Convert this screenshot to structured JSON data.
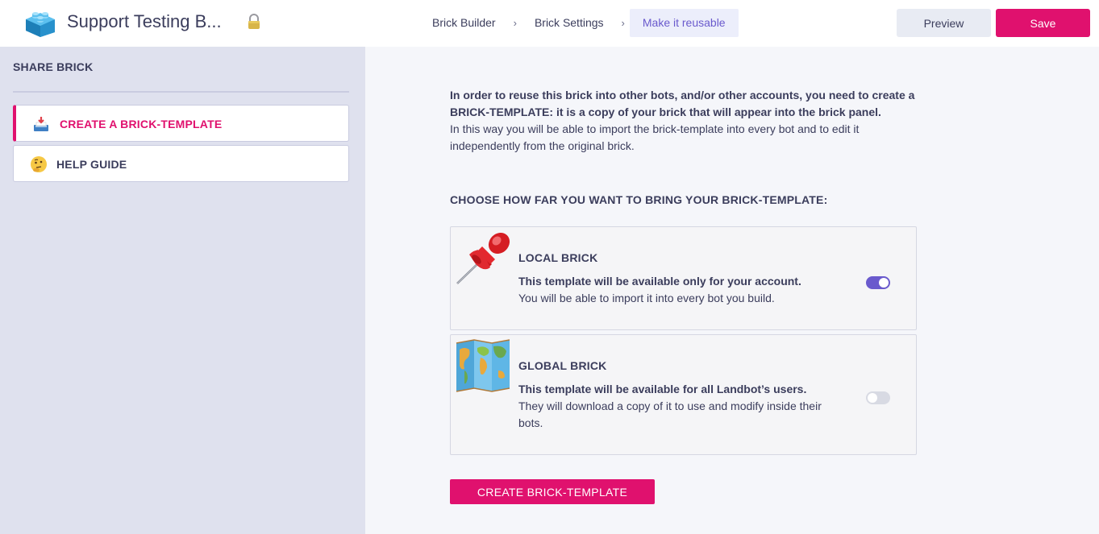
{
  "header": {
    "app_title": "Support Testing B...",
    "breadcrumbs": [
      "Brick Builder",
      "Brick Settings",
      "Make it reusable"
    ],
    "breadcrumb_separator": "›",
    "preview_label": "Preview",
    "save_label": "Save"
  },
  "sidebar": {
    "title": "SHARE BRICK",
    "items": [
      {
        "label": "CREATE A BRICK-TEMPLATE",
        "icon": "inbox-tray-icon",
        "active": true
      },
      {
        "label": "HELP GUIDE",
        "icon": "thinking-face-icon",
        "active": false
      }
    ]
  },
  "main": {
    "intro_bold": "In order to reuse this brick into other bots, and/or other accounts, you need to create a BRICK-TEMPLATE: it is a copy of your brick that will appear into the brick panel.",
    "intro_text": "In this way you will be able to import the brick-template into every bot and to edit it independently from the original brick.",
    "choose_title": "CHOOSE HOW FAR YOU WANT TO BRING YOUR BRICK-TEMPLATE:",
    "cards": [
      {
        "title": "LOCAL BRICK",
        "bold": "This template will be available only for your account.",
        "desc": "You will be able to import it into every bot you build.",
        "icon": "pushpin-icon",
        "enabled": true
      },
      {
        "title": "GLOBAL BRICK",
        "bold": "This template will be available for all Landbot’s users.",
        "desc": "They will download a copy of it to use and modify inside their bots.",
        "icon": "world-map-icon",
        "enabled": false
      }
    ],
    "create_button_label": "CREATE BRICK-TEMPLATE"
  },
  "colors": {
    "accent": "#e0116e",
    "toggle_on": "#6a5acd",
    "sidebar_bg": "#dfe1ee",
    "main_bg": "#f5f6fa"
  }
}
